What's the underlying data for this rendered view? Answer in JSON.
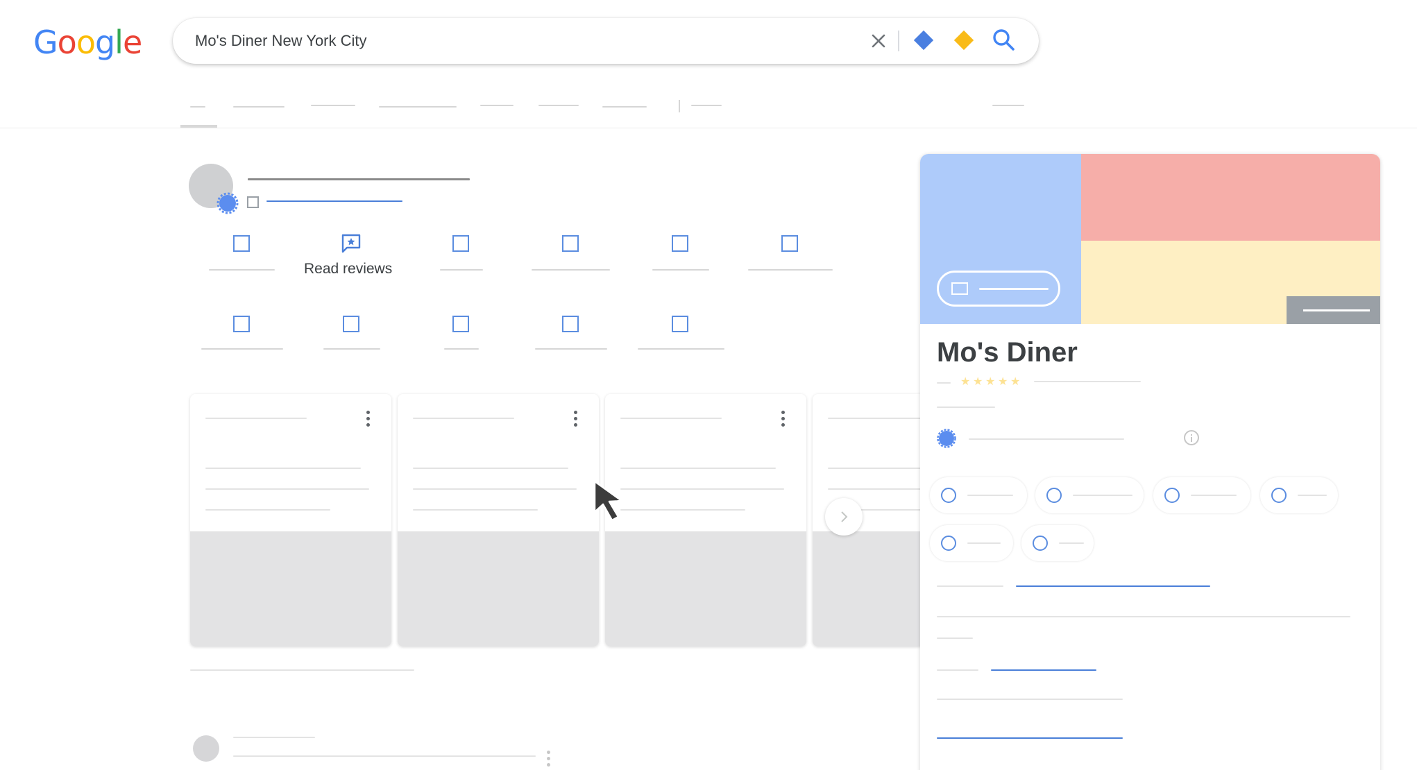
{
  "logo": {
    "text": "Google",
    "letters": [
      {
        "ch": "G",
        "color": "#4285F4"
      },
      {
        "ch": "o",
        "color": "#EA4335"
      },
      {
        "ch": "o",
        "color": "#FBBC05"
      },
      {
        "ch": "g",
        "color": "#4285F4"
      },
      {
        "ch": "l",
        "color": "#34A853"
      },
      {
        "ch": "e",
        "color": "#EA4335"
      }
    ]
  },
  "search": {
    "query": "Mo's Diner New York City"
  },
  "actions": {
    "read_reviews_label": "Read reviews"
  },
  "knowledge_panel": {
    "title": "Mo's Diner"
  },
  "colors": {
    "accent_blue": "#4a7fe0",
    "accent_yellow": "#f9bb18",
    "photo_blue": "#aecbfa",
    "photo_red": "#f6aea9",
    "photo_yellow": "#feefc3"
  },
  "icons": [
    "clear-icon",
    "search-icon",
    "kebab-icon",
    "chevron-right-icon",
    "info-icon",
    "verified-badge-icon",
    "review-icon",
    "mouse-cursor-icon"
  ]
}
